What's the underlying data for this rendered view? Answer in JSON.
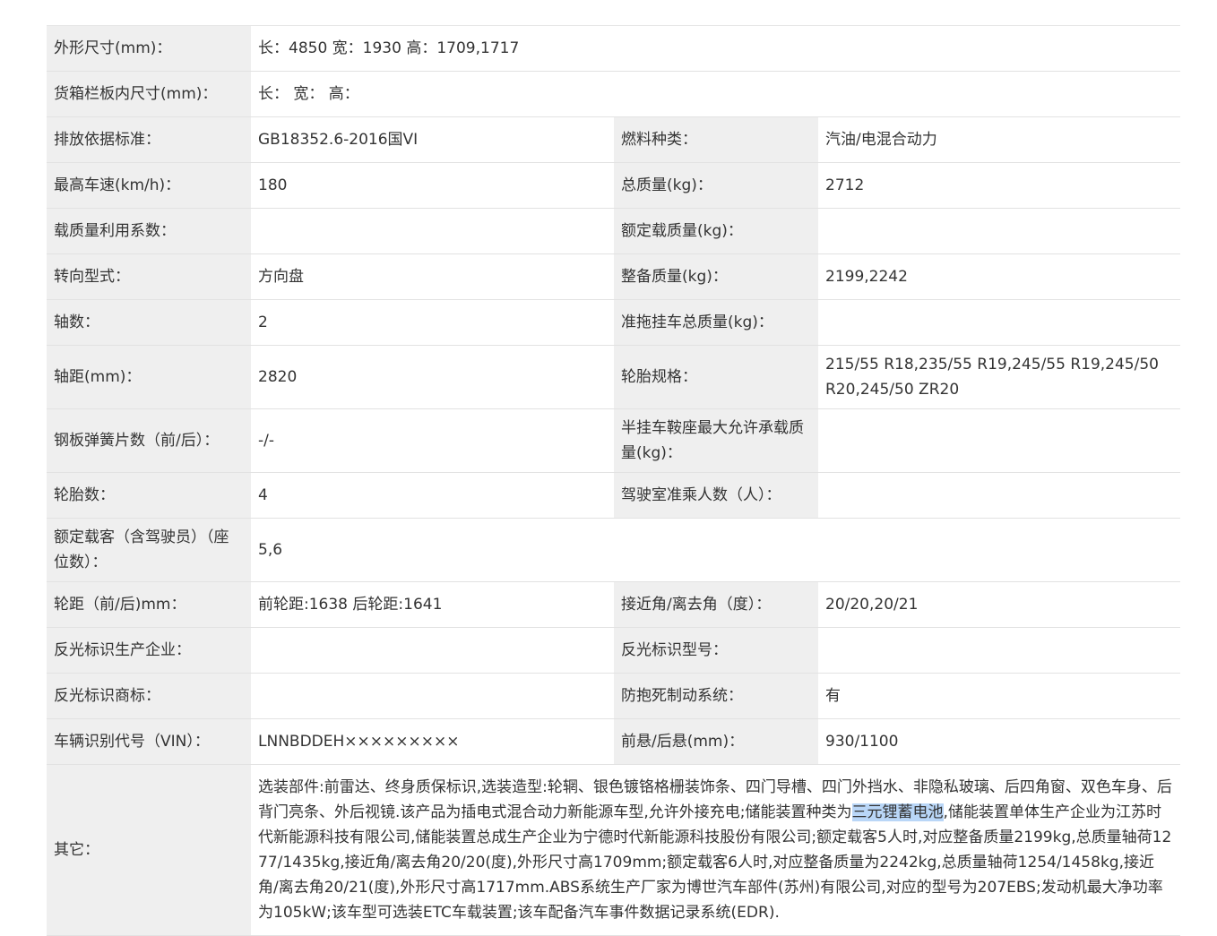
{
  "rows": [
    {
      "label": "外形尺寸(mm)：",
      "value": "长：4850 宽：1930 高：1709,1717"
    },
    {
      "label": "货箱栏板内尺寸(mm)：",
      "value": "长： 宽： 高："
    },
    {
      "label": "排放依据标准：",
      "value": "GB18352.6-2016国VI",
      "label2": "燃料种类：",
      "value2": "汽油/电混合动力"
    },
    {
      "label": "最高车速(km/h)：",
      "value": "180",
      "label2": "总质量(kg)：",
      "value2": "2712"
    },
    {
      "label": "载质量利用系数：",
      "value": "",
      "label2": "额定载质量(kg)：",
      "value2": ""
    },
    {
      "label": "转向型式：",
      "value": "方向盘",
      "label2": "整备质量(kg)：",
      "value2": "2199,2242"
    },
    {
      "label": "轴数：",
      "value": "2",
      "label2": "准拖挂车总质量(kg)：",
      "value2": ""
    },
    {
      "label": "轴距(mm)：",
      "value": "2820",
      "label2": "轮胎规格：",
      "value2": "215/55 R18,235/55 R19,245/55 R19,245/50 R20,245/50 ZR20"
    },
    {
      "label": "钢板弹簧片数（前/后）：",
      "value": "-/-",
      "label2": "半挂车鞍座最大允许承载质量(kg)：",
      "value2": ""
    },
    {
      "label": "轮胎数：",
      "value": "4",
      "label2": "驾驶室准乘人数（人）：",
      "value2": ""
    },
    {
      "label": "额定载客（含驾驶员）（座位数）：",
      "value": "5,6"
    },
    {
      "label": "轮距（前/后)mm：",
      "value": "前轮距:1638 后轮距:1641",
      "label2": "接近角/离去角（度）：",
      "value2": "20/20,20/21"
    },
    {
      "label": "反光标识生产企业：",
      "value": "",
      "label2": "反光标识型号：",
      "value2": ""
    },
    {
      "label": "反光标识商标：",
      "value": "",
      "label2": "防抱死制动系统：",
      "value2": "有"
    },
    {
      "label": "车辆识别代号（VIN）：",
      "value": "LNNBDDEH×××××××××",
      "label2": "前悬/后悬(mm)：",
      "value2": "930/1100"
    }
  ],
  "other": {
    "label": "其它：",
    "text_before": "选装部件:前雷达、终身质保标识,选装造型:轮辋、银色镀铬格栅装饰条、四门导槽、四门外挡水、非隐私玻璃、后四角窗、双色车身、后背门亮条、外后视镜.该产品为插电式混合动力新能源车型,允许外接充电;储能装置种类为",
    "highlight": "三元锂蓄电池",
    "text_after": ",储能装置单体生产企业为江苏时代新能源科技有限公司,储能装置总成生产企业为宁德时代新能源科技股份有限公司;额定载客5人时,对应整备质量2199kg,总质量轴荷1277/1435kg,接近角/离去角20/20(度),外形尺寸高1709mm;额定载客6人时,对应整备质量为2242kg,总质量轴荷1254/1458kg,接近角/离去角20/21(度),外形尺寸高1717mm.ABS系统生产厂家为博世汽车部件(苏州)有限公司,对应的型号为207EBS;发动机最大净功率为105kW;该车型可选装ETC车载装置;该车配备汽车事件数据记录系统(EDR)."
  }
}
